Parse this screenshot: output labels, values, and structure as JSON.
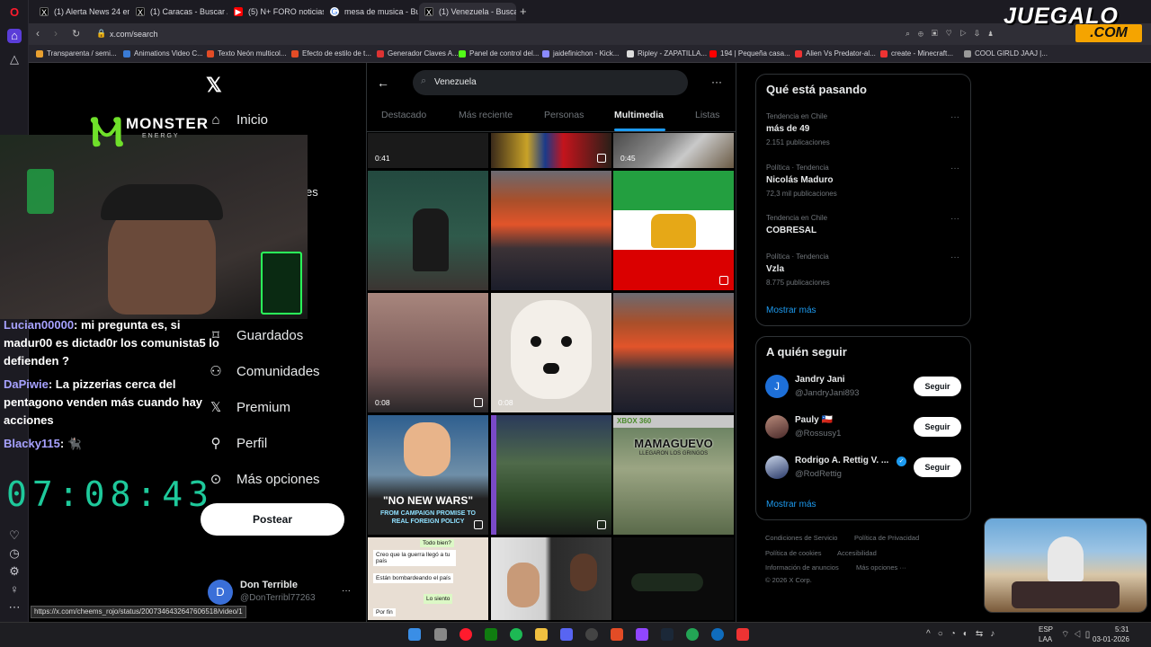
{
  "browser": {
    "tabs": [
      {
        "label": "(1) Alerta News 24 en",
        "icon": "x-logo-icon"
      },
      {
        "label": "(1) Caracas - Buscar / X",
        "icon": "x-logo-icon"
      },
      {
        "label": "(5) N+ FORO noticias en v",
        "icon": "youtube-icon"
      },
      {
        "label": "mesa de musica - Buscar",
        "icon": "google-icon"
      },
      {
        "label": "(1) Venezuela - Buscar / X",
        "icon": "x-logo-icon"
      }
    ],
    "address": "x.com/search",
    "bookmarks": [
      "Transparenta / semi...",
      "Animations Video C...",
      "Texto Neón multicol...",
      "Efecto de estilo de t...",
      "Generador Claves A...",
      "Panel de control del...",
      "jaidefinichon - Kick...",
      "Ripley - ZAPATILLA...",
      "194 | Pequeña casa...",
      "Alien Vs Predator-al...",
      "create - Minecraft...",
      "COOL GIRLD JAAJ |..."
    ],
    "status_url": "https://x.com/cheems_rojo/status/2007346432647606518/video/1"
  },
  "overlay": {
    "brand_top": "JUEGALO",
    "brand_bottom": ".COM",
    "monster": "MONSTER",
    "monster_sub": "ENERGY",
    "timer": "07:08:43",
    "chat": [
      {
        "user": "Lucian00000",
        "text": ": mi pregunta es, si madur00 es dictad0r los comunista5 lo defienden ?"
      },
      {
        "user": "DaPiwie",
        "text": ": La pizzerias cerca del pentagono venden más cuando hay acciones"
      },
      {
        "user": "Blacky115",
        "text": ": 🐈‍⬛"
      }
    ]
  },
  "nav": {
    "items": [
      {
        "label": "Inicio",
        "icon": "home-icon"
      },
      {
        "label": "es",
        "icon": ""
      },
      {
        "label": "Guardados",
        "icon": "bookmark-icon"
      },
      {
        "label": "Comunidades",
        "icon": "communities-icon"
      },
      {
        "label": "Premium",
        "icon": "x-logo-icon"
      },
      {
        "label": "Perfil",
        "icon": "profile-icon"
      },
      {
        "label": "Más opciones",
        "icon": "more-circle-icon"
      }
    ],
    "post_button": "Postear",
    "account": {
      "name": "Don Terrible",
      "handle": "@DonTerribl77263",
      "initial": "D"
    }
  },
  "search": {
    "query": "Venezuela",
    "tabs": [
      "Destacado",
      "Más reciente",
      "Personas",
      "Multimedia",
      "Listas"
    ],
    "active_tab": "Multimedia",
    "media_durations": [
      "0:41",
      "0:45",
      "0:08",
      "0:08"
    ],
    "poster_text": {
      "wars_1": "\"NO NEW WARS\"",
      "wars_2": "FROM CAMPAIGN PROMISE TO",
      "wars_3": "REAL FOREIGN POLICY",
      "xbox": "XBOX 360",
      "game_title": "MAMAGUEVO",
      "game_sub": "LLEGARON LOS GRINGOS"
    },
    "chat_shot": [
      "Todo bien?",
      "Creo que la guerra llegó a tu país",
      "Están bombardeando el país",
      "Lo siento",
      "Por fin"
    ]
  },
  "trends": {
    "title": "Qué está pasando",
    "items": [
      {
        "category": "Tendencia en Chile",
        "name": "más de 49",
        "count": "2.151 publicaciones"
      },
      {
        "category": "Política · Tendencia",
        "name": "Nicolás Maduro",
        "count": "72,3 mil publicaciones"
      },
      {
        "category": "Tendencia en Chile",
        "name": "COBRESAL",
        "count": ""
      },
      {
        "category": "Política · Tendencia",
        "name": "Vzla",
        "count": "8.775 publicaciones"
      }
    ],
    "show_more": "Mostrar más"
  },
  "who_to_follow": {
    "title": "A quién seguir",
    "users": [
      {
        "name": "Jandry Jani",
        "handle": "@JandryJani893",
        "initial": "J"
      },
      {
        "name": "Pauly 🇨🇱",
        "handle": "@Rossusy1",
        "initial": ""
      },
      {
        "name": "Rodrigo A. Rettig V. ...",
        "handle": "@RodRettig",
        "initial": ""
      }
    ],
    "follow_label": "Seguir",
    "show_more": "Mostrar más"
  },
  "footer": {
    "links": [
      "Condiciones de Servicio",
      "Política de Privacidad",
      "Política de cookies",
      "Accesibilidad",
      "Información de anuncios",
      "Más opciones ···"
    ],
    "copyright": "© 2026 X Corp."
  },
  "taskbar": {
    "lang": "ESP",
    "lang2": "LAA",
    "time": "5:31",
    "date": "03-01-2026"
  },
  "colors": {
    "accent": "#1d9bf0",
    "timer": "#1ec99b",
    "chat_user": "#a7a2ff"
  }
}
